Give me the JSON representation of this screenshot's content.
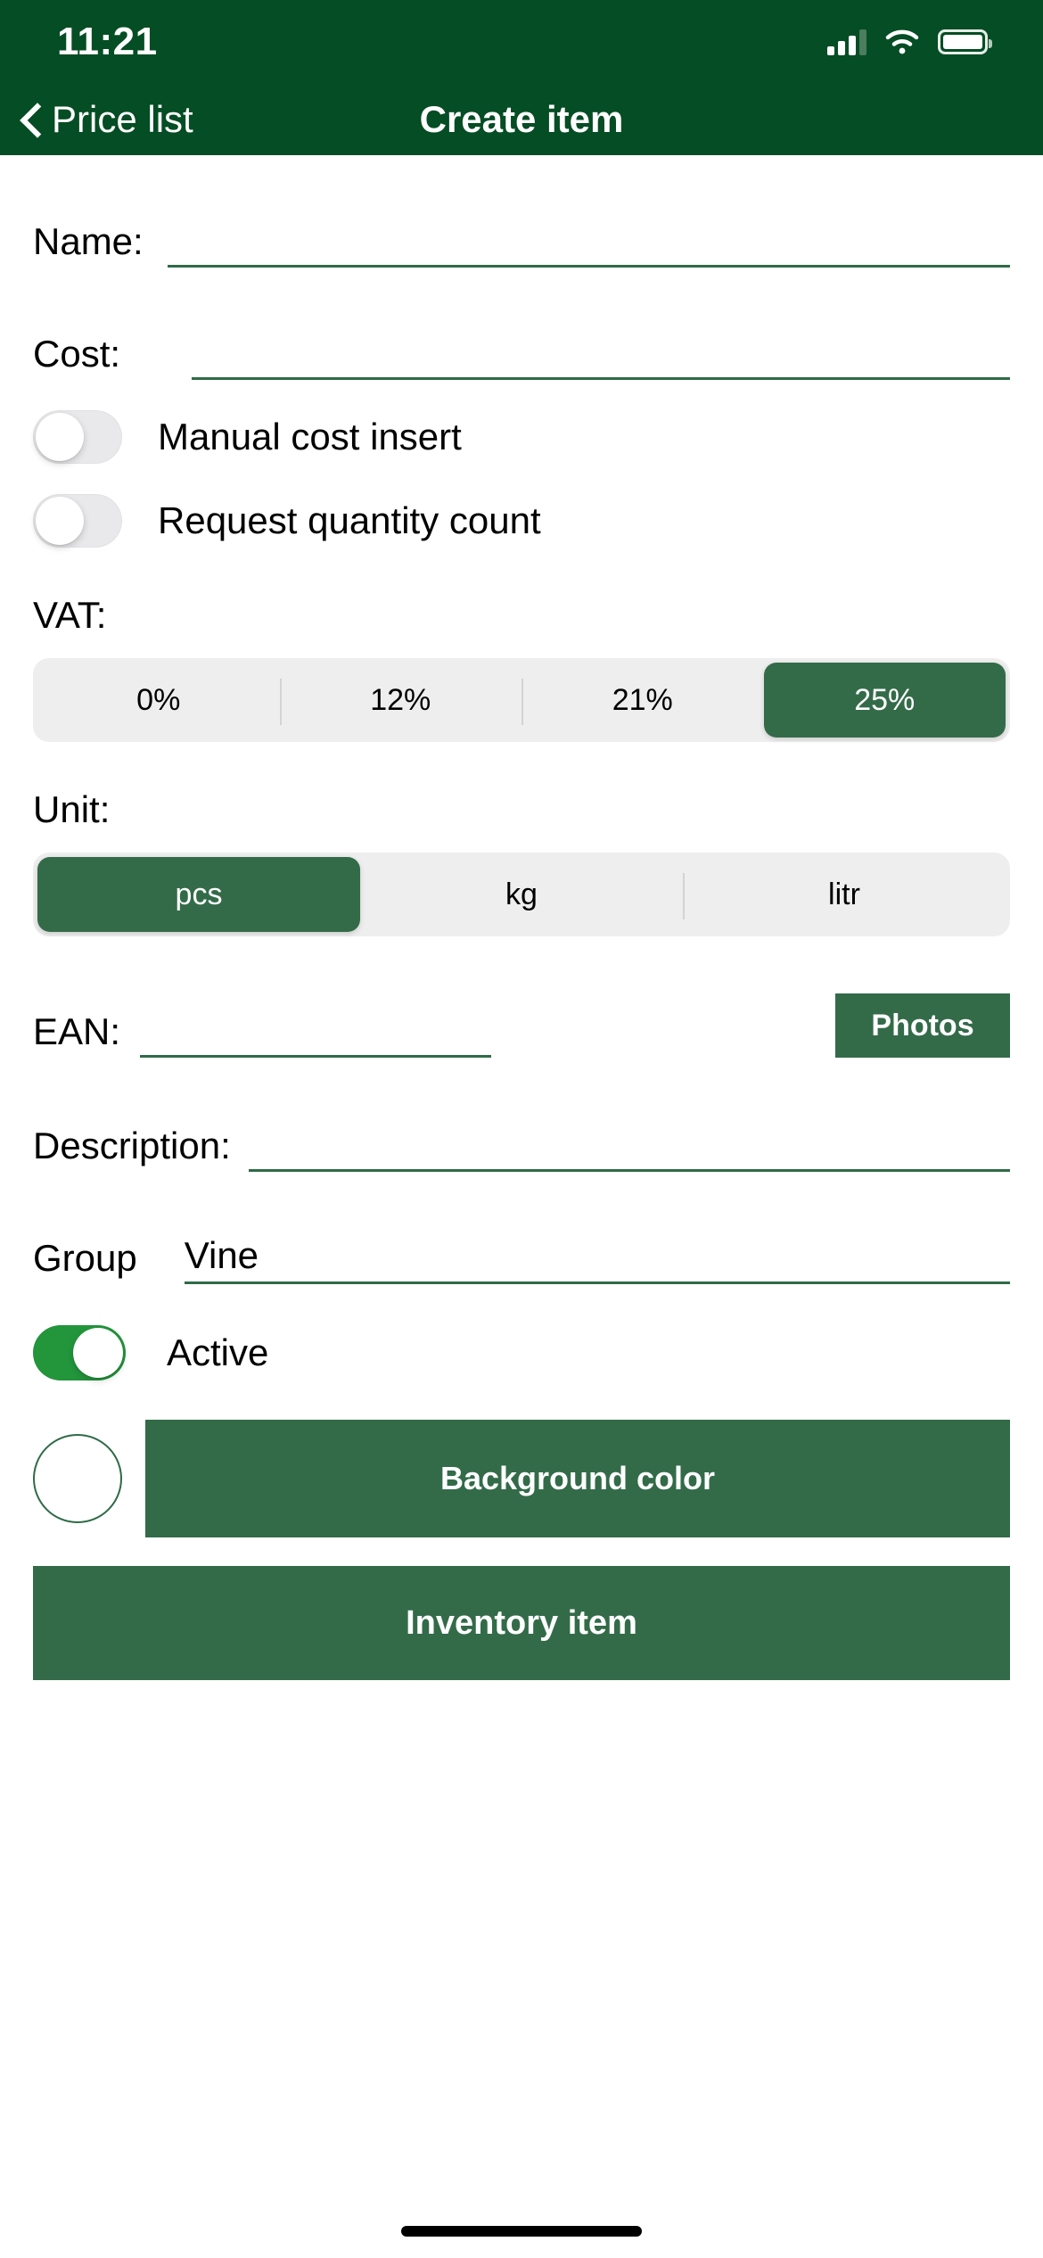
{
  "status_bar": {
    "time": "11:21",
    "cell_icon": "cellular-signal-icon",
    "wifi_icon": "wifi-icon",
    "battery_icon": "battery-full-icon"
  },
  "nav": {
    "back_icon": "chevron-left-icon",
    "back_label": "Price list",
    "title": "Create item"
  },
  "form": {
    "name": {
      "label": "Name:",
      "value": "",
      "placeholder": ""
    },
    "cost": {
      "label": "Cost:",
      "value": "",
      "placeholder": ""
    },
    "manual_cost": {
      "label": "Manual cost insert",
      "on": false
    },
    "request_quantity": {
      "label": "Request quantity count",
      "on": false
    },
    "vat": {
      "label": "VAT:",
      "options": [
        "0%",
        "12%",
        "21%",
        "25%"
      ],
      "selected": "25%"
    },
    "unit": {
      "label": "Unit:",
      "options": [
        "pcs",
        "kg",
        "litr"
      ],
      "selected": "pcs"
    },
    "ean": {
      "label": "EAN:",
      "value": "",
      "placeholder": ""
    },
    "photos_button": "Photos",
    "description": {
      "label": "Description:",
      "value": "",
      "placeholder": ""
    },
    "group": {
      "label": "Group",
      "value": "Vine",
      "placeholder": ""
    },
    "active": {
      "label": "Active",
      "on": true
    },
    "background_color": {
      "swatch_color": "#ffffff",
      "button_label": "Background color"
    },
    "inventory_button": "Inventory item"
  },
  "colors": {
    "header_green": "#054d24",
    "accent_green": "#336b49",
    "toggle_on_green": "#23963c",
    "segment_track": "#eeeeee",
    "underline_green": "#2e6b47"
  }
}
